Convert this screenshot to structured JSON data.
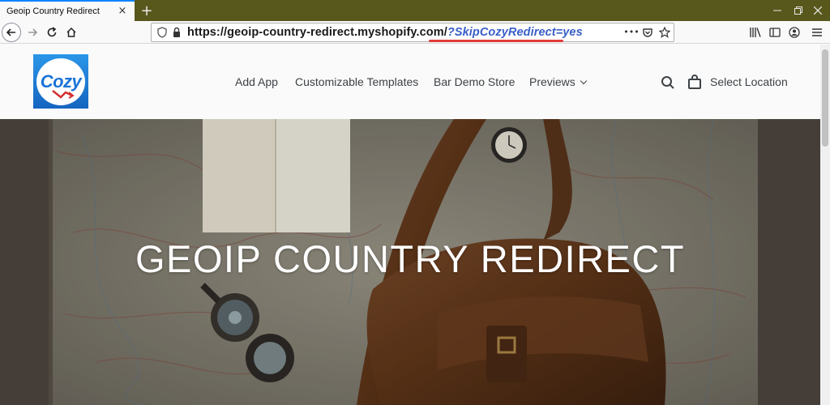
{
  "browser": {
    "tab_title": "Geoip Country Redirect",
    "tab_close": "×",
    "new_tab": "+",
    "url_base": "https://geoip-country-redirect.myshopify.com/",
    "url_param": "?SkipCozyRedirect=yes",
    "url_menu": "•••"
  },
  "site": {
    "logo_text": "Cozy",
    "nav": {
      "add_app": "Add App",
      "templates": "Customizable Templates",
      "bar_demo": "Bar Demo Store",
      "previews": "Previews",
      "select_location": "Select Location"
    },
    "hero_title": "GEOIP COUNTRY REDIRECT"
  },
  "colors": {
    "tabstrip": "#58581d",
    "accent": "#0a84ff",
    "url_param": "#3a5fc8",
    "underline": "#e23a3a"
  }
}
